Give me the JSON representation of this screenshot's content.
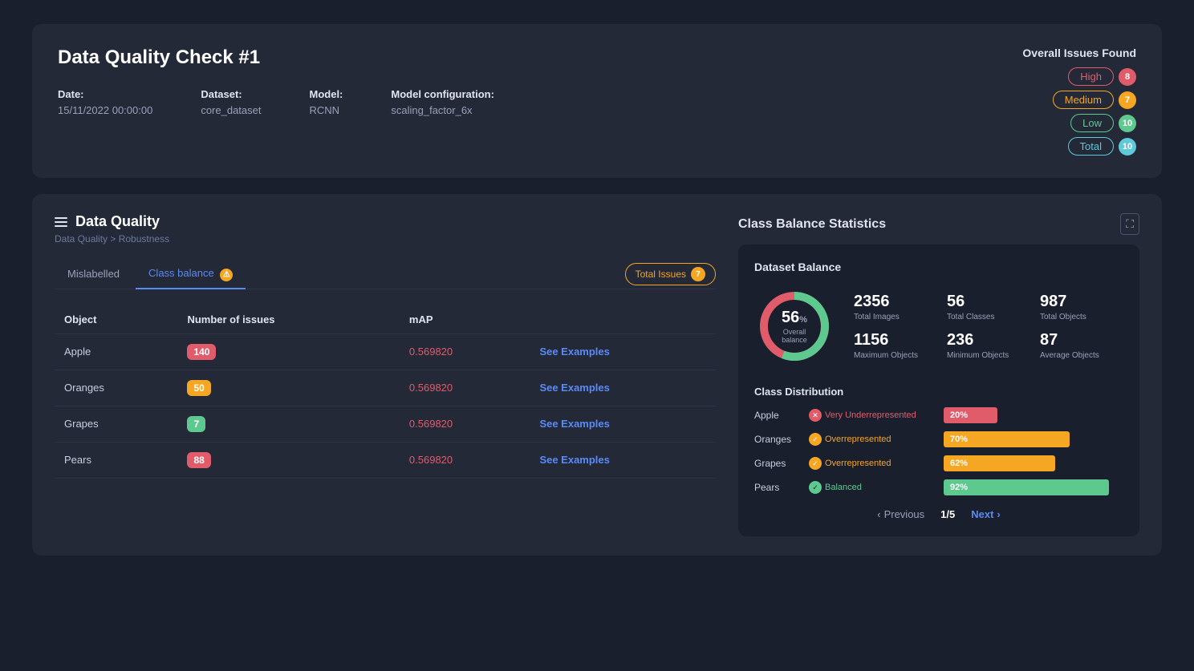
{
  "topCard": {
    "title": "Data Quality Check #1",
    "meta": {
      "date_label": "Date:",
      "date_value": "15/11/2022  00:00:00",
      "dataset_label": "Dataset:",
      "dataset_value": "core_dataset",
      "model_label": "Model:",
      "model_value": "RCNN",
      "model_config_label": "Model configuration:",
      "model_config_value": "scaling_factor_6x"
    },
    "overallIssues": {
      "title": "Overall Issues Found",
      "badges": [
        {
          "label": "High",
          "count": "8",
          "type": "high"
        },
        {
          "label": "Medium",
          "count": "7",
          "type": "medium"
        },
        {
          "label": "Low",
          "count": "10",
          "type": "low"
        },
        {
          "label": "Total",
          "count": "10",
          "type": "total"
        }
      ]
    }
  },
  "dataQuality": {
    "title": "Data Quality",
    "breadcrumb": "Data Quality > Robustness",
    "tabs": [
      {
        "label": "Mislabelled",
        "active": false
      },
      {
        "label": "Class balance",
        "active": true,
        "warning": true
      }
    ],
    "totalIssues": {
      "label": "Total Issues",
      "count": "7"
    },
    "table": {
      "headers": [
        "Object",
        "Number of issues",
        "mAP"
      ],
      "rows": [
        {
          "object": "Apple",
          "issues": "140",
          "issues_color": "red",
          "map": "0.569820",
          "action": "See Examples"
        },
        {
          "object": "Oranges",
          "issues": "50",
          "issues_color": "orange",
          "map": "0.569820",
          "action": "See Examples"
        },
        {
          "object": "Grapes",
          "issues": "7",
          "issues_color": "green",
          "map": "0.569820",
          "action": "See Examples"
        },
        {
          "object": "Pears",
          "issues": "88",
          "issues_color": "red",
          "map": "0.569820",
          "action": "See Examples"
        }
      ]
    }
  },
  "classBalance": {
    "title": "Class Balance Statistics",
    "datasetBalance": {
      "title": "Dataset Balance",
      "donut": {
        "percentage": "56",
        "label": "Overall balance",
        "filled": 56,
        "colors": {
          "green": "#5ec98e",
          "red": "#e05c6a"
        }
      },
      "stats": [
        {
          "value": "2356",
          "label": "Total Images"
        },
        {
          "value": "56",
          "label": "Total Classes"
        },
        {
          "value": "987",
          "label": "Total Objects"
        },
        {
          "value": "1156",
          "label": "Maximum Objects"
        },
        {
          "value": "236",
          "label": "Minimum Objects"
        },
        {
          "value": "87",
          "label": "Average Objects"
        }
      ]
    },
    "classDistribution": {
      "title": "Class Distribution",
      "items": [
        {
          "class": "Apple",
          "status": "Very Underrepresented",
          "status_type": "red",
          "pct": "20%"
        },
        {
          "class": "Oranges",
          "status": "Overrepresented",
          "status_type": "orange",
          "pct": "70%"
        },
        {
          "class": "Grapes",
          "status": "Overrepresented",
          "status_type": "orange",
          "pct": "62%"
        },
        {
          "class": "Pears",
          "status": "Balanced",
          "status_type": "green",
          "pct": "92%"
        }
      ]
    },
    "pagination": {
      "previous": "Previous",
      "next": "Next",
      "current": "1/5"
    }
  }
}
